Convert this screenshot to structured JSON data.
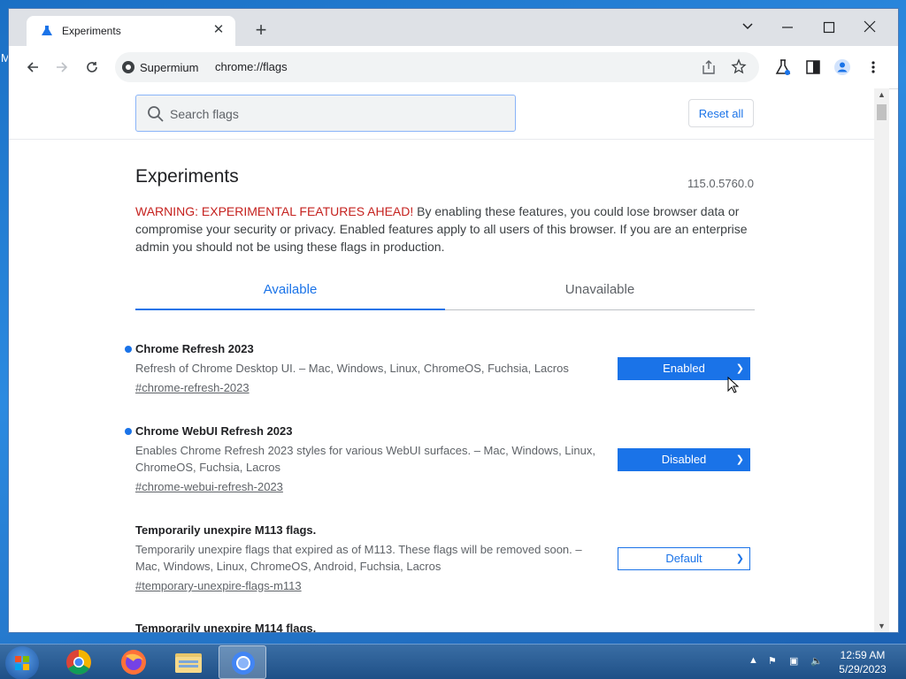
{
  "browser": {
    "tab_title": "Experiments",
    "new_tab_symbol": "+",
    "close_symbol": "✕",
    "site_chip": "Supermium",
    "url": "chrome://flags"
  },
  "page": {
    "search_placeholder": "Search flags",
    "reset_label": "Reset all",
    "title": "Experiments",
    "version": "115.0.5760.0",
    "warning_prefix": "WARNING: EXPERIMENTAL FEATURES AHEAD!",
    "warning_body": " By enabling these features, you could lose browser data or compromise your security or privacy. Enabled features apply to all users of this browser. If you are an enterprise admin you should not be using these flags in production.",
    "tabs": [
      "Available",
      "Unavailable"
    ],
    "flags": [
      {
        "name": "Chrome Refresh 2023",
        "desc": "Refresh of Chrome Desktop UI. – Mac, Windows, Linux, ChromeOS, Fuchsia, Lacros",
        "link": "#chrome-refresh-2023",
        "value": "Enabled"
      },
      {
        "name": "Chrome WebUI Refresh 2023",
        "desc": "Enables Chrome Refresh 2023 styles for various WebUI surfaces. – Mac, Windows, Linux, ChromeOS, Fuchsia, Lacros",
        "link": "#chrome-webui-refresh-2023",
        "value": "Disabled"
      },
      {
        "name": "Temporarily unexpire M113 flags.",
        "desc": "Temporarily unexpire flags that expired as of M113. These flags will be removed soon. – Mac, Windows, Linux, ChromeOS, Android, Fuchsia, Lacros",
        "link": "#temporary-unexpire-flags-m113",
        "value": "Default"
      },
      {
        "name": "Temporarily unexpire M114 flags."
      }
    ]
  },
  "taskbar": {
    "time": "12:59 AM",
    "date": "5/29/2023"
  },
  "desktop": {
    "edge_text": "M"
  },
  "colors": {
    "accent": "#1a73e8",
    "warning": "#c5221f"
  }
}
